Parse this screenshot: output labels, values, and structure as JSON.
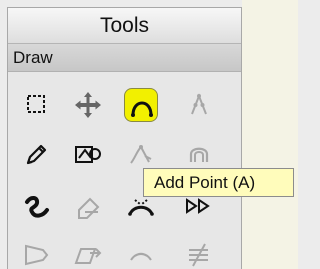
{
  "panel": {
    "title": "Tools",
    "section_label": "Draw"
  },
  "tools": [
    {
      "icon": "rectangle-selection-icon",
      "state": "enabled"
    },
    {
      "icon": "move-arrows-icon",
      "state": "enabled"
    },
    {
      "icon": "add-point-icon",
      "state": "selected"
    },
    {
      "icon": "insert-point-icon",
      "state": "disabled"
    },
    {
      "icon": "pencil-icon",
      "state": "enabled"
    },
    {
      "icon": "shape-edit-icon",
      "state": "enabled"
    },
    {
      "icon": "curve-control-icon",
      "state": "disabled"
    },
    {
      "icon": "arch-tool-icon",
      "state": "disabled"
    },
    {
      "icon": "freehand-curve-icon",
      "state": "enabled"
    },
    {
      "icon": "eraser-icon",
      "state": "disabled"
    },
    {
      "icon": "bezier-curve-icon",
      "state": "enabled"
    },
    {
      "icon": "play-arrows-icon",
      "state": "enabled"
    },
    {
      "icon": "shield-shape-icon",
      "state": "disabled"
    },
    {
      "icon": "shape-transform-icon",
      "state": "disabled"
    },
    {
      "icon": "curve-sweep-icon",
      "state": "disabled"
    },
    {
      "icon": "strikethrough-lines-icon",
      "state": "disabled"
    }
  ],
  "tooltip": {
    "text": "Add Point (A)"
  },
  "colors": {
    "selected_tool_bg": "#f2f000",
    "tooltip_bg": "#fffcbb",
    "canvas_bg": "#f4f3e5"
  }
}
